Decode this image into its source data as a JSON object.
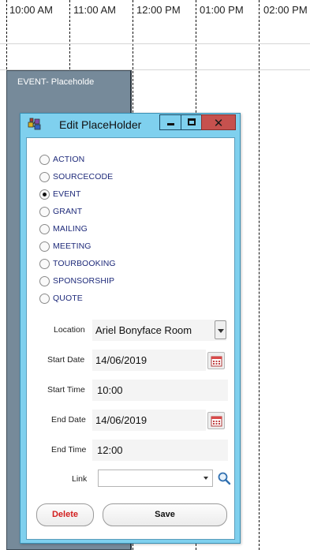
{
  "timeline": {
    "hours": [
      "10:00 AM",
      "11:00 AM",
      "12:00 PM",
      "01:00 PM",
      "02:00 PM"
    ]
  },
  "event": {
    "title": "EVENT- Placeholde",
    "color": "#768a9a"
  },
  "dialog": {
    "title": "Edit PlaceHolder",
    "title_bar_color": "#7fd0ee",
    "close_color": "#c6514e",
    "type_options": [
      {
        "label": "ACTION",
        "checked": false
      },
      {
        "label": "SOURCECODE",
        "checked": false
      },
      {
        "label": "EVENT",
        "checked": true
      },
      {
        "label": "GRANT",
        "checked": false
      },
      {
        "label": "MAILING",
        "checked": false
      },
      {
        "label": "MEETING",
        "checked": false
      },
      {
        "label": "TOURBOOKING",
        "checked": false
      },
      {
        "label": "SPONSORSHIP",
        "checked": false
      },
      {
        "label": "QUOTE",
        "checked": false
      }
    ],
    "location": {
      "label": "Location",
      "value": "Ariel Bonyface Room"
    },
    "start_date": {
      "label": "Start Date",
      "value": "14/06/2019"
    },
    "start_time": {
      "label": "Start Time",
      "value": "10:00"
    },
    "end_date": {
      "label": "End Date",
      "value": "14/06/2019"
    },
    "end_time": {
      "label": "End Time",
      "value": "12:00"
    },
    "link": {
      "label": "Link",
      "value": ""
    },
    "buttons": {
      "delete": "Delete",
      "save": "Save",
      "delete_color": "#d21f1f"
    }
  }
}
